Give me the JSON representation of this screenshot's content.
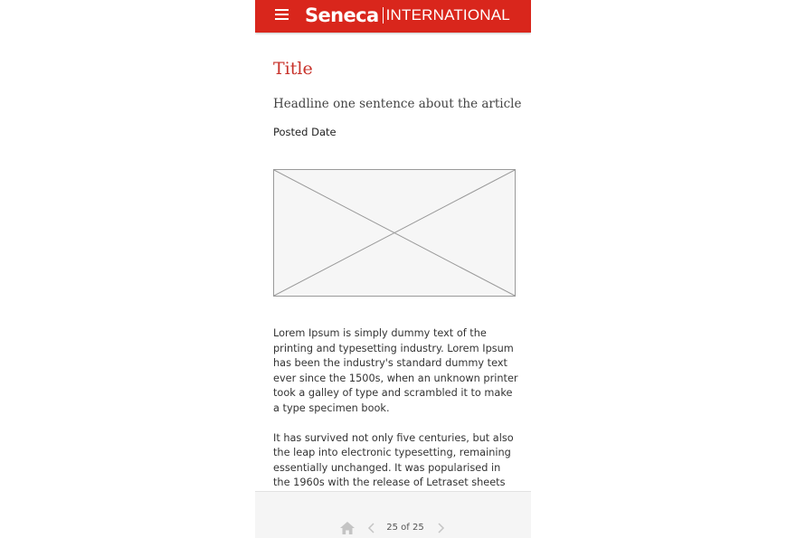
{
  "header": {
    "logo_bold": "Seneca",
    "logo_light": "INTERNATIONAL",
    "menu_icon": "hamburger-menu-icon",
    "brand_color": "#d9261c"
  },
  "article": {
    "title": "Title",
    "headline": "Headline one sentence about the article",
    "posted_date": "Posted Date",
    "image_placeholder_icon": "image-placeholder-icon",
    "paragraphs": [
      "Lorem Ipsum is simply dummy text of the printing and typesetting industry. Lorem Ipsum has been the industry's standard dummy text ever since the 1500s, when an unknown printer took a galley of type and scrambled it to make a type specimen book.",
      "It has survived not only five centuries, but also the leap into electronic typesetting, remaining essentially unchanged. It was popularised in the 1960s with the release of Letraset sheets"
    ],
    "title_color": "#c8322a"
  },
  "footer": {
    "page_indicator": "25 of 25",
    "home_icon": "home-icon",
    "prev_icon": "chevron-left-icon",
    "next_icon": "chevron-right-icon"
  }
}
